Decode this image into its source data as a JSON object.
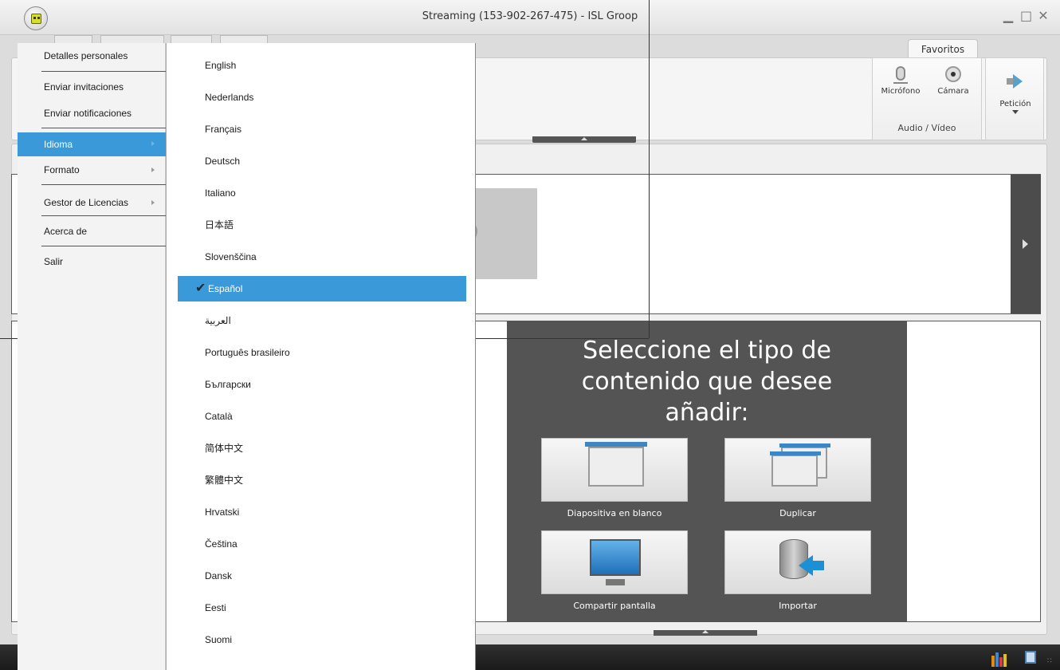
{
  "window": {
    "title": "Streaming (153-902-267-475) - ISL Groop",
    "controls": [
      "minimize-icon",
      "maximize-icon",
      "close-icon"
    ]
  },
  "ribbon": {
    "tab": "Favoritos",
    "audio_video_group": {
      "label": "Audio / Vídeo",
      "buttons": [
        {
          "label": "Micrófono",
          "icon": "microphone-icon"
        },
        {
          "label": "Cámara",
          "icon": "camera-icon"
        }
      ]
    },
    "request_button": {
      "label": "Petición",
      "icon": "megaphone-icon"
    }
  },
  "main_menu": {
    "items": [
      {
        "label": "Detalles personales",
        "has_submenu": false
      },
      {
        "label": "Enviar invitaciones",
        "has_submenu": false
      },
      {
        "label": "Enviar notificaciones",
        "has_submenu": false
      },
      {
        "label": "Idioma",
        "has_submenu": true,
        "active": true
      },
      {
        "label": "Formato",
        "has_submenu": true
      },
      {
        "label": "Gestor de Licencias",
        "has_submenu": true
      },
      {
        "label": "Acerca de",
        "has_submenu": false
      },
      {
        "label": "Salir",
        "has_submenu": false
      }
    ]
  },
  "language_menu": {
    "selected": "Español",
    "items": [
      "English",
      "Nederlands",
      "Français",
      "Deutsch",
      "Italiano",
      "日本語",
      "Slovenščina",
      "Español",
      "العربية",
      "Português brasileiro",
      "Български",
      "Català",
      "简体中文",
      "繁體中文",
      "Hrvatski",
      "Čeština",
      "Dansk",
      "Eesti",
      "Suomi"
    ]
  },
  "content_panel": {
    "title": "Seleccione el tipo de contenido que desee añadir:",
    "buttons": [
      {
        "label": "Diapositiva en blanco",
        "icon": "blank-slide-icon"
      },
      {
        "label": "Duplicar",
        "icon": "duplicate-slide-icon"
      },
      {
        "label": "Compartir pantalla",
        "icon": "monitor-icon"
      },
      {
        "label": "Importar",
        "icon": "database-import-icon"
      }
    ]
  },
  "colors": {
    "menu_highlight": "#3a9ad9",
    "panel_background": "#545454",
    "taskbar": "#1a1a1a"
  }
}
